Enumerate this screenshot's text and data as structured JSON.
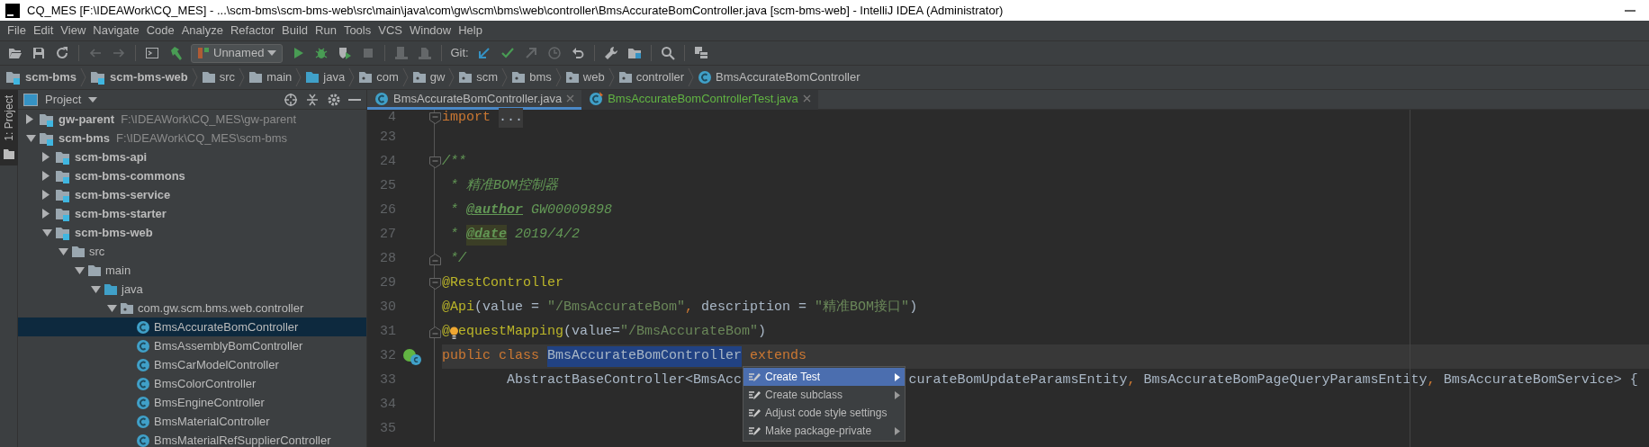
{
  "window": {
    "title": "CQ_MES [F:\\IDEAWork\\CQ_MES] - ...\\scm-bms\\scm-bms-web\\src\\main\\java\\com\\gw\\scm\\bms\\web\\controller\\BmsAccurateBomController.java [scm-bms-web] - IntelliJ IDEA (Administrator)"
  },
  "menu": [
    "File",
    "Edit",
    "View",
    "Navigate",
    "Code",
    "Analyze",
    "Refactor",
    "Build",
    "Run",
    "Tools",
    "VCS",
    "Window",
    "Help"
  ],
  "toolbar": [
    [
      {
        "kind": "open",
        "disabled": false
      },
      {
        "kind": "save",
        "disabled": false
      },
      {
        "kind": "sync",
        "disabled": false
      }
    ],
    [
      {
        "kind": "back",
        "disabled": true
      },
      {
        "kind": "forward",
        "disabled": true
      }
    ],
    [
      {
        "kind": "terminal",
        "disabled": false
      },
      {
        "kind": "build",
        "disabled": false
      },
      {
        "kind": "run-config",
        "label": "Unnamed",
        "disabled": false
      },
      {
        "kind": "run",
        "disabled": false
      },
      {
        "kind": "debug",
        "disabled": false
      },
      {
        "kind": "coverage",
        "disabled": false
      },
      {
        "kind": "stop",
        "disabled": true
      }
    ],
    [
      {
        "kind": "artifact",
        "disabled": true
      },
      {
        "kind": "deploy",
        "disabled": true
      }
    ],
    [
      {
        "kind": "git-label",
        "label": "Git:",
        "disabled": false
      },
      {
        "kind": "update",
        "disabled": false
      },
      {
        "kind": "commit",
        "disabled": false
      },
      {
        "kind": "push",
        "disabled": true
      },
      {
        "kind": "history",
        "disabled": true
      },
      {
        "kind": "revert",
        "disabled": false
      }
    ],
    [
      {
        "kind": "settings",
        "disabled": false
      },
      {
        "kind": "structure",
        "disabled": false
      }
    ],
    [
      {
        "kind": "search",
        "disabled": false
      }
    ],
    [
      {
        "kind": "sdk",
        "disabled": false
      }
    ]
  ],
  "breadcrumb": [
    {
      "label": "scm-bms",
      "kind": "module"
    },
    {
      "label": "scm-bms-web",
      "kind": "module"
    },
    {
      "label": "src",
      "kind": "folder"
    },
    {
      "label": "main",
      "kind": "folder"
    },
    {
      "label": "java",
      "kind": "source-root"
    },
    {
      "label": "com",
      "kind": "package"
    },
    {
      "label": "gw",
      "kind": "package"
    },
    {
      "label": "scm",
      "kind": "package"
    },
    {
      "label": "bms",
      "kind": "package"
    },
    {
      "label": "web",
      "kind": "package"
    },
    {
      "label": "controller",
      "kind": "package"
    },
    {
      "label": "BmsAccurateBomController",
      "kind": "class"
    }
  ],
  "side_stripe": {
    "label": "1: Project",
    "selected": true
  },
  "project": {
    "title": "Project",
    "tree": [
      {
        "label": "gw-parent",
        "path": "F:\\IDEAWork\\CQ_MES\\gw-parent",
        "kind": "module",
        "expanded": false,
        "selected": false
      },
      {
        "label": "scm-bms",
        "path": "F:\\IDEAWork\\CQ_MES\\scm-bms",
        "kind": "module",
        "expanded": true,
        "selected": false,
        "children": [
          {
            "label": "scm-bms-api",
            "kind": "module",
            "expanded": false,
            "selected": false
          },
          {
            "label": "scm-bms-commons",
            "kind": "module",
            "expanded": false,
            "selected": false
          },
          {
            "label": "scm-bms-service",
            "kind": "module",
            "expanded": false,
            "selected": false
          },
          {
            "label": "scm-bms-starter",
            "kind": "module",
            "expanded": false,
            "selected": false
          },
          {
            "label": "scm-bms-web",
            "kind": "module",
            "expanded": true,
            "selected": false,
            "children": [
              {
                "label": "src",
                "kind": "folder",
                "expanded": true,
                "selected": false,
                "children": [
                  {
                    "label": "main",
                    "kind": "folder",
                    "expanded": true,
                    "selected": false,
                    "children": [
                      {
                        "label": "java",
                        "kind": "source-root",
                        "expanded": true,
                        "selected": false,
                        "children": [
                          {
                            "label": "com.gw.scm.bms.web.controller",
                            "kind": "package",
                            "expanded": true,
                            "selected": false,
                            "children": [
                              {
                                "label": "BmsAccurateBomController",
                                "kind": "class",
                                "selected": true
                              },
                              {
                                "label": "BmsAssemblyBomController",
                                "kind": "class",
                                "selected": false
                              },
                              {
                                "label": "BmsCarModelController",
                                "kind": "class",
                                "selected": false
                              },
                              {
                                "label": "BmsColorController",
                                "kind": "class",
                                "selected": false
                              },
                              {
                                "label": "BmsEngineController",
                                "kind": "class",
                                "selected": false
                              },
                              {
                                "label": "BmsMaterialController",
                                "kind": "class",
                                "selected": false
                              },
                              {
                                "label": "BmsMaterialRefSupplierController",
                                "kind": "class",
                                "selected": false
                              }
                            ]
                          }
                        ]
                      }
                    ]
                  }
                ]
              }
            ]
          }
        ]
      }
    ]
  },
  "editor": {
    "tabs": [
      {
        "label": "BmsAccurateBomController.java",
        "selected": true,
        "color": "#bbbbbb",
        "kind": "class"
      },
      {
        "label": "BmsAccurateBomControllerTest.java",
        "selected": false,
        "color": "#62b543",
        "kind": "test-class"
      }
    ],
    "lines": [
      {
        "number": "4",
        "current": false,
        "fold_start": true,
        "fold_end": false,
        "implemented": false,
        "tokens": [
          {
            "text": "import",
            "kind": "keyword"
          },
          {
            "text": "...",
            "kind": "folded"
          }
        ]
      },
      {
        "number": "23",
        "current": false,
        "fold_start": false,
        "fold_end": false,
        "implemented": false
      },
      {
        "number": "24",
        "current": false,
        "fold_start": true,
        "fold_end": false,
        "implemented": false,
        "tokens": [
          {
            "text": "/**",
            "kind": "doc"
          }
        ]
      },
      {
        "number": "25",
        "current": false,
        "fold_start": false,
        "fold_end": false,
        "implemented": false,
        "tokens": [
          {
            "text": " * 精准BOM控制器",
            "kind": "doc"
          }
        ]
      },
      {
        "number": "26",
        "current": false,
        "fold_start": false,
        "fold_end": false,
        "implemented": false,
        "tokens": [
          {
            "text": " * ",
            "kind": "doc"
          },
          {
            "text": "@author",
            "kind": "doctag"
          },
          {
            "text": " GW00009898",
            "kind": "doc"
          }
        ]
      },
      {
        "number": "27",
        "current": false,
        "fold_start": false,
        "fold_end": false,
        "implemented": false,
        "tokens": [
          {
            "text": " * ",
            "kind": "doc"
          },
          {
            "text": "@date",
            "kind": "doctag-marked"
          },
          {
            "text": " 2019/4/2",
            "kind": "doc"
          }
        ]
      },
      {
        "number": "28",
        "current": false,
        "fold_start": false,
        "fold_end": true,
        "implemented": false,
        "tokens": [
          {
            "text": " */",
            "kind": "doc"
          }
        ]
      },
      {
        "number": "29",
        "current": false,
        "fold_start": true,
        "fold_end": false,
        "implemented": false,
        "tokens": [
          {
            "text": "@RestController",
            "kind": "annotation"
          }
        ]
      },
      {
        "number": "30",
        "current": false,
        "fold_start": false,
        "fold_end": false,
        "implemented": false,
        "tokens": [
          {
            "text": "@Api",
            "kind": "annotation"
          },
          {
            "text": "(value = ",
            "kind": "plain"
          },
          {
            "text": "\"/BmsAccurateBom\"",
            "kind": "string"
          },
          {
            "text": ", ",
            "kind": "punct"
          },
          {
            "text": "description = ",
            "kind": "plain"
          },
          {
            "text": "\"精准BOM接口\"",
            "kind": "string"
          },
          {
            "text": ")",
            "kind": "plain"
          }
        ]
      },
      {
        "number": "31",
        "current": false,
        "fold_start": false,
        "fold_end": true,
        "implemented": false,
        "tokens": [
          {
            "text": "@",
            "kind": "annotation"
          },
          {
            "kind": "bulb"
          },
          {
            "text": "equestMapping",
            "kind": "annotation"
          },
          {
            "text": "(value=",
            "kind": "plain"
          },
          {
            "text": "\"/BmsAccurateBom\"",
            "kind": "string"
          },
          {
            "text": ")",
            "kind": "plain"
          }
        ]
      },
      {
        "number": "32",
        "current": true,
        "fold_start": false,
        "fold_end": false,
        "implemented": true,
        "tokens": [
          {
            "text": "public class ",
            "kind": "keyword"
          },
          {
            "text": "BmsAccurateBomController",
            "kind": "selected"
          },
          {
            "text": " extends",
            "kind": "keyword"
          }
        ]
      },
      {
        "number": "33",
        "current": false,
        "fold_start": false,
        "fold_end": false,
        "implemented": false,
        "tokens": [
          {
            "text": "        AbstractBaseController<BmsAcc",
            "kind": "plain"
          },
          {
            "kind": "covered"
          },
          {
            "text": "curateBomUpdateParamsEntity",
            "kind": "plain"
          },
          {
            "text": ", ",
            "kind": "punct"
          },
          {
            "text": "BmsAccurateBomPageQueryParamsEntity",
            "kind": "plain"
          },
          {
            "text": ", ",
            "kind": "punct"
          },
          {
            "text": "BmsAccurateBomService> {",
            "kind": "plain"
          }
        ]
      },
      {
        "number": "34",
        "current": false,
        "fold_start": false,
        "fold_end": false,
        "implemented": false
      },
      {
        "number": "35",
        "current": false,
        "fold_start": false,
        "fold_end": false,
        "implemented": false
      }
    ],
    "popup": [
      {
        "label": "Create Test",
        "selected": true,
        "submenu": true
      },
      {
        "label": "Create subclass",
        "selected": false,
        "submenu": true
      },
      {
        "label": "Adjust code style settings",
        "selected": false,
        "submenu": false
      },
      {
        "label": "Make package-private",
        "selected": false,
        "submenu": true
      }
    ]
  }
}
